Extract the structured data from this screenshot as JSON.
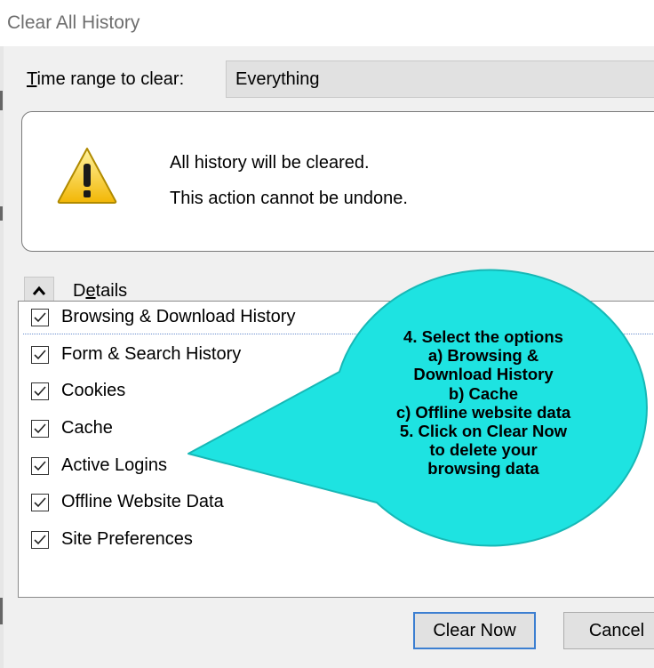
{
  "window": {
    "title": "Clear All History"
  },
  "time_range": {
    "label": "Time range to clear:",
    "selected": "Everything"
  },
  "warning": {
    "line1": "All history will be cleared.",
    "line2": "This action cannot be undone."
  },
  "details": {
    "label": "Details",
    "expanded": true
  },
  "items": [
    {
      "label": "Browsing & Download History",
      "checked": true
    },
    {
      "label": "Form & Search History",
      "checked": true
    },
    {
      "label": "Cookies",
      "checked": true
    },
    {
      "label": "Cache",
      "checked": true
    },
    {
      "label": "Active Logins",
      "checked": true
    },
    {
      "label": "Offline Website Data",
      "checked": true
    },
    {
      "label": "Site Preferences",
      "checked": true
    }
  ],
  "buttons": {
    "clear_now": "Clear Now",
    "cancel": "Cancel"
  },
  "callout": {
    "lines": [
      "4. Select the options",
      "a) Browsing &",
      "Download History",
      "b) Cache",
      "c) Offline website data",
      "5. Click on Clear Now",
      "to delete your",
      "browsing data"
    ]
  },
  "colors": {
    "callout_fill": "#1ee3e1",
    "warning_yellow": "#f6c915",
    "focus_blue": "#3c7fd1"
  }
}
